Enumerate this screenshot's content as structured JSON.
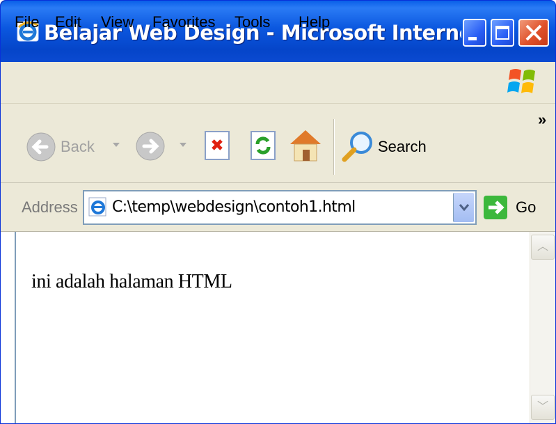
{
  "window": {
    "title": "Belajar Web Design - Microsoft Internet Explo...",
    "title_bar_color": "#0b57df",
    "close_button_color": "#e0512a"
  },
  "menu": {
    "items": [
      "File",
      "Edit",
      "View",
      "Favorites",
      "Tools",
      "Help"
    ]
  },
  "toolbar": {
    "back_label": "Back",
    "search_label": "Search",
    "more_label": "»",
    "icons": [
      "back-arrow-icon",
      "forward-arrow-icon",
      "stop-icon",
      "refresh-icon",
      "home-icon",
      "search-magnifier-icon"
    ]
  },
  "address": {
    "label": "Address",
    "value": "C:\\temp\\webdesign\\contoh1.html",
    "go_label": "Go"
  },
  "page": {
    "text": "ini adalah halaman HTML"
  }
}
